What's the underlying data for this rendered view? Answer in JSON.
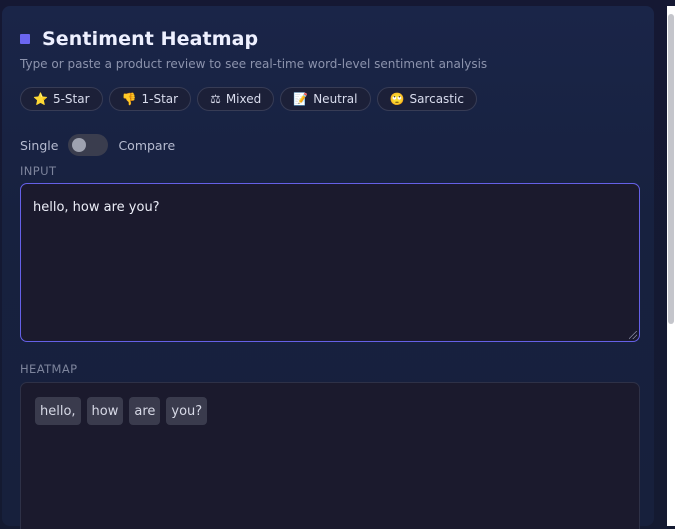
{
  "header": {
    "title": "Sentiment Heatmap",
    "subtitle": "Type or paste a product review to see real-time word-level sentiment analysis"
  },
  "presets": [
    {
      "icon": "⭐",
      "label": "5-Star"
    },
    {
      "icon": "👎",
      "label": "1-Star"
    },
    {
      "icon": "⚖",
      "label": "Mixed"
    },
    {
      "icon": "📝",
      "label": "Neutral"
    },
    {
      "icon": "🙄",
      "label": "Sarcastic"
    }
  ],
  "mode": {
    "left_label": "Single",
    "right_label": "Compare",
    "compare_enabled": false
  },
  "input": {
    "label": "INPUT",
    "value": "hello, how are you?"
  },
  "heatmap": {
    "label": "HEATMAP",
    "tokens": [
      "hello,",
      "how",
      "are",
      "you?"
    ]
  },
  "colors": {
    "accent": "#6b66f0",
    "neutral_token": "#3a3b4d"
  }
}
